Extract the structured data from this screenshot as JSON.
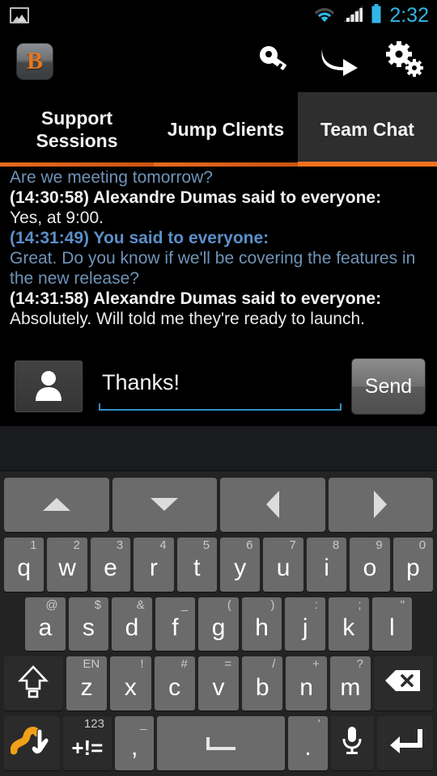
{
  "status_bar": {
    "notification_icon": "gallery-icon",
    "wifi_icon": "wifi-icon",
    "signal_icon": "cellular-signal-icon",
    "battery_icon": "battery-icon",
    "time": "2:32",
    "accent_color": "#33b5e5"
  },
  "action_bar": {
    "app_logo_letter": "B",
    "logo_color": "#e8761f",
    "actions": [
      {
        "name": "key-icon",
        "label": "key"
      },
      {
        "name": "jump-arrow-icon",
        "label": "jump"
      },
      {
        "name": "gear-icon",
        "label": "settings"
      }
    ]
  },
  "tabs": {
    "items": [
      {
        "label": "Support\nSessions",
        "selected": false
      },
      {
        "label": "Jump Clients",
        "selected": false
      },
      {
        "label": "Team Chat",
        "selected": true
      }
    ],
    "accent_color": "#f4711f"
  },
  "chat": {
    "messages": [
      {
        "header": "",
        "body": "Are we meeting tomorrow?",
        "self": true,
        "clipped": true
      },
      {
        "header": "(14:30:58) Alexandre Dumas said to everyone:",
        "body": "Yes, at 9:00.",
        "self": false
      },
      {
        "header": "(14:31:49) You said to everyone:",
        "body": "Great. Do you know if we'll be covering the features in the new release?",
        "self": true
      },
      {
        "header": "(14:31:58) Alexandre Dumas said to everyone:",
        "body": "Absolutely. Will told me they're ready to launch.",
        "self": false
      }
    ]
  },
  "compose": {
    "avatar_icon": "person-icon",
    "input_value": "Thanks!",
    "input_placeholder": "",
    "send_label": "Send",
    "underline_color": "#2f90c4"
  },
  "keyboard": {
    "nav_row": [
      {
        "name": "arrow-up-key",
        "glyph": "up"
      },
      {
        "name": "arrow-down-key",
        "glyph": "down"
      },
      {
        "name": "arrow-left-key",
        "glyph": "left"
      },
      {
        "name": "arrow-right-key",
        "glyph": "right"
      }
    ],
    "row1": [
      {
        "main": "q",
        "alt": "1"
      },
      {
        "main": "w",
        "alt": "2"
      },
      {
        "main": "e",
        "alt": "3"
      },
      {
        "main": "r",
        "alt": "4"
      },
      {
        "main": "t",
        "alt": "5"
      },
      {
        "main": "y",
        "alt": "6"
      },
      {
        "main": "u",
        "alt": "7"
      },
      {
        "main": "i",
        "alt": "8"
      },
      {
        "main": "o",
        "alt": "9"
      },
      {
        "main": "p",
        "alt": "0"
      }
    ],
    "row2": [
      {
        "main": "a",
        "alt": "@"
      },
      {
        "main": "s",
        "alt": "$"
      },
      {
        "main": "d",
        "alt": "&"
      },
      {
        "main": "f",
        "alt": "_"
      },
      {
        "main": "g",
        "alt": "("
      },
      {
        "main": "h",
        "alt": ")"
      },
      {
        "main": "j",
        "alt": ":"
      },
      {
        "main": "k",
        "alt": ";"
      },
      {
        "main": "l",
        "alt": "\""
      }
    ],
    "row3": [
      {
        "main": "z",
        "alt": "EN"
      },
      {
        "main": "x",
        "alt": "!"
      },
      {
        "main": "c",
        "alt": "#"
      },
      {
        "main": "v",
        "alt": "="
      },
      {
        "main": "b",
        "alt": "/"
      },
      {
        "main": "n",
        "alt": "+"
      },
      {
        "main": "m",
        "alt": "?"
      }
    ],
    "shift_key": {
      "name": "shift-key",
      "icon": "shift-arrow-icon"
    },
    "backspace_key": {
      "name": "backspace-key",
      "icon": "backspace-icon"
    },
    "gesture_key": {
      "name": "swype-gesture-key",
      "icon": "swype-hand-icon"
    },
    "symbols_key": {
      "name": "symbols-key",
      "main": "+!=",
      "alt": "123"
    },
    "comma_key": {
      "main": ",",
      "alt": "_"
    },
    "space_key": {
      "name": "space-key",
      "icon": "spacebar-icon"
    },
    "period_key": {
      "main": ".",
      "alt": "'"
    },
    "mic_key": {
      "name": "microphone-key",
      "icon": "microphone-icon"
    },
    "enter_key": {
      "name": "enter-key",
      "icon": "enter-arrow-icon"
    }
  }
}
